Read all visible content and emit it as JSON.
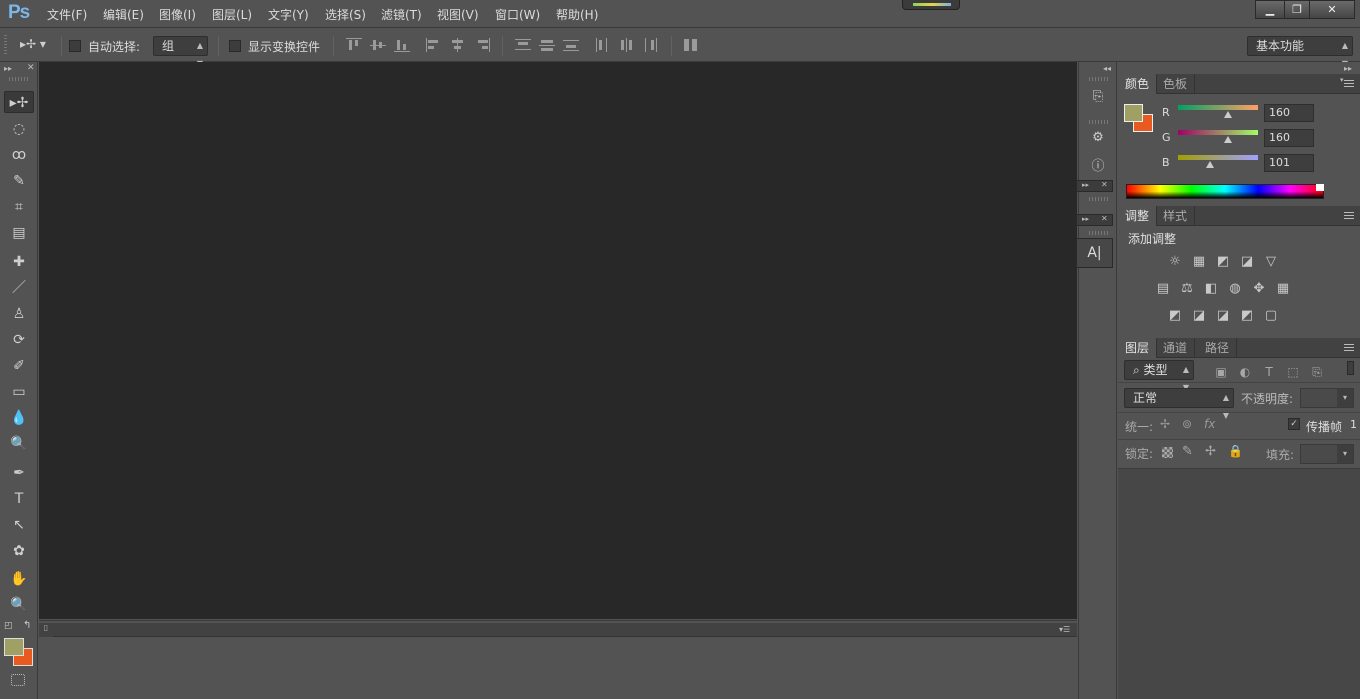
{
  "app": {
    "logo": "Ps"
  },
  "menu": [
    "文件(F)",
    "编辑(E)",
    "图像(I)",
    "图层(L)",
    "文字(Y)",
    "选择(S)",
    "滤镜(T)",
    "视图(V)",
    "窗口(W)",
    "帮助(H)"
  ],
  "window_controls": {
    "minimize": "▁",
    "restore": "❐",
    "close": "✕"
  },
  "options_bar": {
    "auto_select_label": "自动选择:",
    "auto_select_value": "组",
    "show_transform_label": "显示变换控件",
    "workspace": "基本功能"
  },
  "tools": [
    "move",
    "marquee",
    "lasso",
    "quick-select",
    "crop",
    "eyedropper",
    "healing-brush",
    "brush",
    "clone-stamp",
    "history-brush",
    "eraser",
    "gradient",
    "blur",
    "dodge",
    "pen",
    "type",
    "path-select",
    "shape",
    "hand",
    "zoom"
  ],
  "tool_glyphs": [
    "▸✢",
    "◌",
    "ꝏ",
    "✎",
    "⌗",
    "▤",
    "✚",
    "／",
    "♙",
    "⟳",
    "✐",
    "▭",
    "💧",
    "🔍",
    "✒",
    "T",
    "↖",
    "✿",
    "✋",
    "🔍"
  ],
  "color_panel": {
    "tabs": [
      "颜色",
      "色板"
    ],
    "fg_color": "#a0a065",
    "bg_color": "#e85a1f",
    "channels": [
      {
        "label": "R",
        "value": "160"
      },
      {
        "label": "G",
        "value": "160"
      },
      {
        "label": "B",
        "value": "101"
      }
    ]
  },
  "adjustments_panel": {
    "tabs": [
      "调整",
      "样式"
    ],
    "title": "添加调整",
    "row1": [
      "☼",
      "▦",
      "◩",
      "◪",
      "▽"
    ],
    "row2": [
      "▤",
      "⚖",
      "◧",
      "◍",
      "✥",
      "▦"
    ],
    "row3": [
      "◩",
      "◪",
      "◪",
      "◩",
      "▢"
    ]
  },
  "layers_panel": {
    "tabs": [
      "图层",
      "通道",
      "路径"
    ],
    "filter_label": "类型",
    "blend_mode": "正常",
    "opacity_label": "不透明度:",
    "unify_label": "统一:",
    "propagate_label": "传播帧",
    "propagate_value": "1",
    "lock_label": "锁定:",
    "fill_label": "填充:"
  },
  "mini_panel": {
    "text_icon": "A|"
  }
}
